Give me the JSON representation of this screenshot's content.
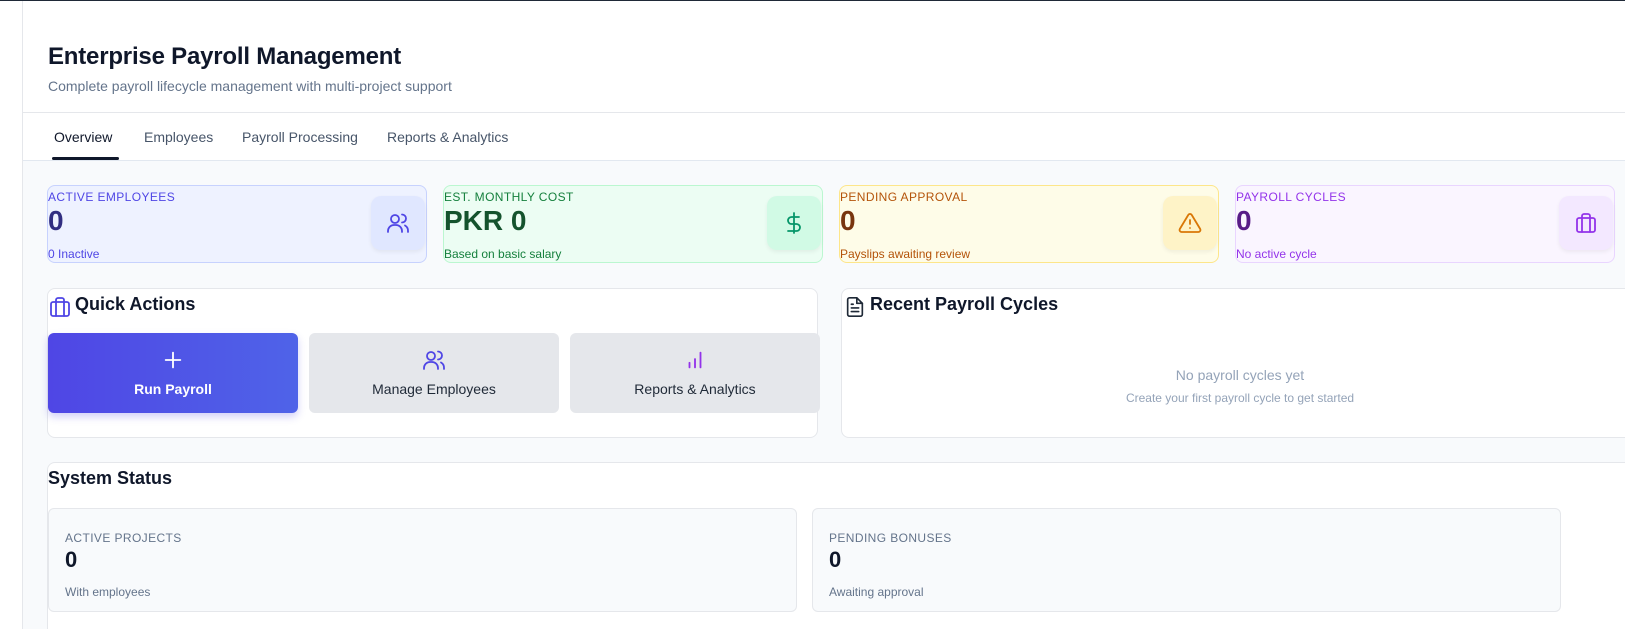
{
  "header": {
    "title": "Enterprise Payroll Management",
    "subtitle": "Complete payroll lifecycle management with multi-project support"
  },
  "tabs": [
    {
      "label": "Overview",
      "active": true
    },
    {
      "label": "Employees",
      "active": false
    },
    {
      "label": "Payroll Processing",
      "active": false
    },
    {
      "label": "Reports & Analytics",
      "active": false
    }
  ],
  "stats": [
    {
      "label": "ACTIVE EMPLOYEES",
      "value": "0",
      "sub": "0 Inactive",
      "icon": "users-icon",
      "color": "#4f46e5"
    },
    {
      "label": "EST. MONTHLY COST",
      "value": "PKR 0",
      "sub": "Based on basic salary",
      "icon": "dollar-icon",
      "color": "#059669"
    },
    {
      "label": "PENDING APPROVAL",
      "value": "0",
      "sub": "Payslips awaiting review",
      "icon": "warning-icon",
      "color": "#d97706"
    },
    {
      "label": "PAYROLL CYCLES",
      "value": "0",
      "sub": "No active cycle",
      "icon": "briefcase-icon",
      "color": "#9333ea"
    }
  ],
  "quick_actions": {
    "title": "Quick Actions",
    "buttons": [
      {
        "label": "Run Payroll",
        "icon": "plus-icon"
      },
      {
        "label": "Manage Employees",
        "icon": "users-icon"
      },
      {
        "label": "Reports & Analytics",
        "icon": "bar-chart-icon"
      }
    ]
  },
  "recent_cycles": {
    "title": "Recent Payroll Cycles",
    "empty_title": "No payroll cycles yet",
    "empty_subtitle": "Create your first payroll cycle to get started"
  },
  "system_status": {
    "title": "System Status",
    "cards": [
      {
        "label": "ACTIVE PROJECTS",
        "value": "0",
        "sub": "With employees"
      },
      {
        "label": "PENDING BONUSES",
        "value": "0",
        "sub": "Awaiting approval"
      }
    ]
  },
  "colors": {
    "primary": "#4f46e5",
    "text": "#0f172a",
    "muted": "#64748b"
  }
}
